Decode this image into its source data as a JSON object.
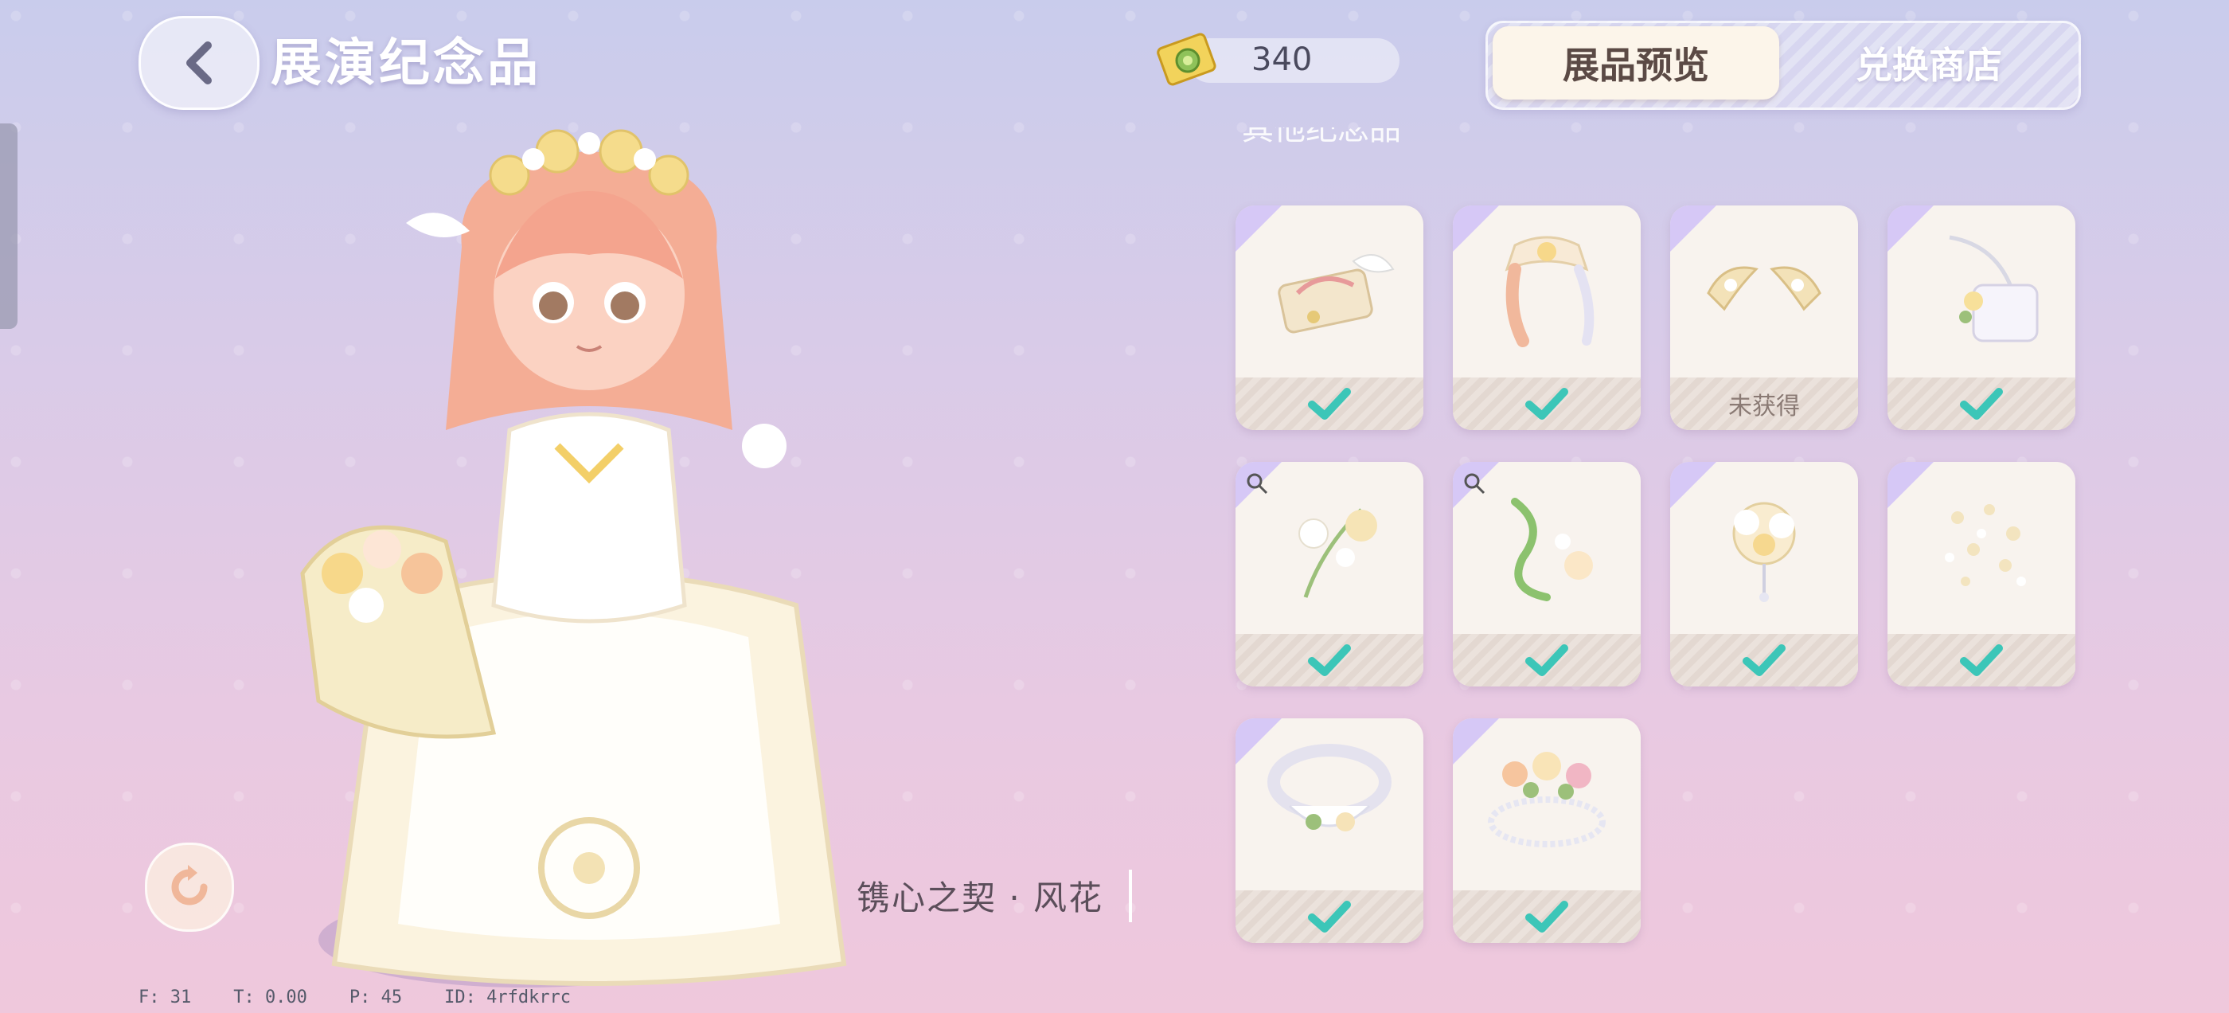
{
  "header": {
    "title": "展演纪念品",
    "currency_value": "340",
    "tabs": [
      {
        "label": "展品预览",
        "active": true
      },
      {
        "label": "兑换商店",
        "active": false
      }
    ]
  },
  "section": {
    "partial_title": "其他纪念品"
  },
  "items": [
    {
      "icon": "hair-accessory-icon",
      "status": "check",
      "status_text": ""
    },
    {
      "icon": "bow-ribbon-icon",
      "status": "check",
      "status_text": ""
    },
    {
      "icon": "wings-ornament-icon",
      "status": "locked",
      "status_text": "未获得"
    },
    {
      "icon": "handbag-icon",
      "status": "check",
      "status_text": ""
    },
    {
      "icon": "flower-vine-icon",
      "status": "check",
      "status_text": "",
      "zoom": true
    },
    {
      "icon": "green-vine-icon",
      "status": "check",
      "status_text": "",
      "zoom": true
    },
    {
      "icon": "flower-brooch-icon",
      "status": "check",
      "status_text": ""
    },
    {
      "icon": "petal-effect-icon",
      "status": "check",
      "status_text": ""
    },
    {
      "icon": "floral-collar-icon",
      "status": "check",
      "status_text": ""
    },
    {
      "icon": "flower-crown-icon",
      "status": "check",
      "status_text": ""
    }
  ],
  "character": {
    "outfit_name": "镌心之契 · 风花"
  },
  "debug": {
    "text": "F: 31    T: 0.00    P: 45    ID: 4rfdkrrc"
  },
  "colors": {
    "check": "#3cc6b8",
    "tab_active_bg": "#fcf5ea",
    "card_bg": "#f8f3ee"
  }
}
